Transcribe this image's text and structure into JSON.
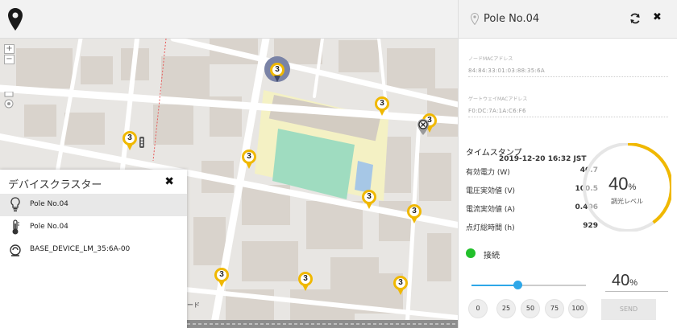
{
  "map": {
    "marker_labels": [
      "3",
      "3",
      "3",
      "3",
      "3",
      "3",
      "3",
      "3",
      "3",
      "3",
      "3",
      "3"
    ],
    "road_label": "ード"
  },
  "cluster_panel": {
    "title": "デバイスクラスター",
    "close_glyph": "✖",
    "items": [
      {
        "label": "Pole No.04",
        "icon": "lightbulb-icon",
        "active": true
      },
      {
        "label": "Pole No.04",
        "icon": "thermometer-icon",
        "active": false
      },
      {
        "label": "BASE_DEVICE_LM_35:6A-00",
        "icon": "sensor-icon",
        "active": false
      }
    ]
  },
  "panel": {
    "title": "Pole No.04",
    "close_glyph": "✖",
    "node_mac_label": "ノードMACアドレス",
    "node_mac_value": "84:84:33:01:03:88:35:6A",
    "gateway_mac_label": "ゲートウェイMACアドレス",
    "gateway_mac_value": "F0:DC:7A:1A:C6:F6",
    "timestamp_label": "タイムスタンプ",
    "timestamp_value": "2019-12-20 16:32 JST",
    "metrics": [
      {
        "label": "有効電力 (W)",
        "value": "40.7"
      },
      {
        "label": "電圧実効値 (V)",
        "value": "100.5"
      },
      {
        "label": "電流実効値 (A)",
        "value": "0.406"
      },
      {
        "label": "点灯総時間 (h)",
        "value": "929"
      }
    ],
    "gauge_value": "40",
    "gauge_unit": "%",
    "gauge_fraction": 0.4,
    "gauge_label": "調光レベル",
    "connection_label": "接続",
    "connection_color": "#22c02b",
    "slider_fraction": 0.4,
    "dim_value": "40",
    "dim_unit": "%",
    "presets": [
      "0",
      "25",
      "50",
      "75",
      "100"
    ],
    "send_label": "SEND",
    "accent_color": "#2ea7e8",
    "gauge_color": "#f0b800"
  }
}
